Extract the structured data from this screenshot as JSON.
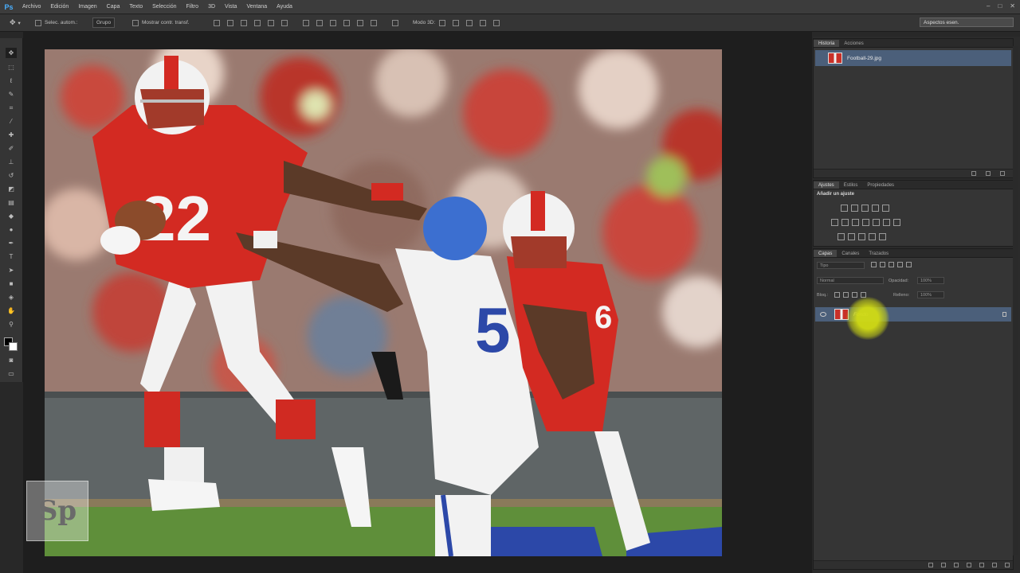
{
  "app": {
    "logo": "Ps"
  },
  "menu": [
    "Archivo",
    "Edición",
    "Imagen",
    "Capa",
    "Texto",
    "Selección",
    "Filtro",
    "3D",
    "Vista",
    "Ventana",
    "Ayuda"
  ],
  "window_controls": [
    "–",
    "□",
    "✕"
  ],
  "options_bar": {
    "auto_select_label": "Selec. autom.:",
    "auto_select_value": "Grupo",
    "show_transform_label": "Mostrar contr. transf.",
    "mode_3d_label": "Modo 3D:"
  },
  "workspace": {
    "value": "Aspectos esen."
  },
  "history_panel": {
    "tabs": [
      "Historia",
      "Acciones"
    ],
    "item": "Football-29.jpg"
  },
  "adjustments_panel": {
    "tabs": [
      "Ajustes",
      "Estilos",
      "Propiedades"
    ],
    "subtitle": "Añadir un ajuste"
  },
  "layers_panel": {
    "tabs": [
      "Capas",
      "Canales",
      "Trazados"
    ],
    "filter_label": "Tipo",
    "blend_mode": "Normal",
    "opacity_label": "Opacidad:",
    "opacity_value": "100%",
    "lock_label": "Bloq.:",
    "fill_label": "Relleno:",
    "fill_value": "100%",
    "layer_name": "Fondo"
  },
  "watermark": {
    "text": "Sp"
  },
  "colors": {
    "accent_selection": "#4b5f7a",
    "cursor_highlight": "#d2dc14",
    "jersey_red": "#c83028"
  }
}
